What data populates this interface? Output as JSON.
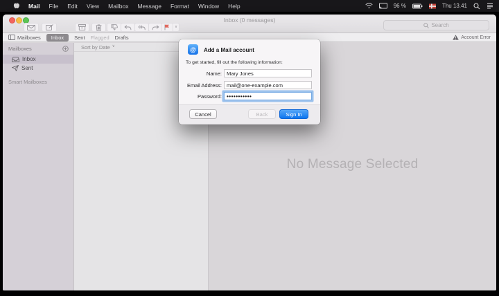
{
  "menu_bar": {
    "items": [
      "Mail",
      "File",
      "Edit",
      "View",
      "Mailbox",
      "Message",
      "Format",
      "Window",
      "Help"
    ],
    "status": {
      "battery": "96 %",
      "clock": "Thu 13.41"
    }
  },
  "window": {
    "title": "Inbox (0 messages)",
    "toolbar": {
      "search_placeholder": "Search"
    },
    "favorites": {
      "mailboxes": "Mailboxes",
      "inbox": "Inbox",
      "sent": "Sent",
      "flagged": "Flagged",
      "drafts": "Drafts",
      "account_error": "Account Error"
    },
    "sidebar": {
      "header": "Mailboxes",
      "inbox": "Inbox",
      "sent": "Sent",
      "smart": "Smart Mailboxes"
    },
    "list": {
      "sort_label": "Sort by Date"
    },
    "message_view": {
      "empty_text": "No Message Selected"
    }
  },
  "dialog": {
    "title": "Add a Mail account",
    "subtitle": "To get started, fill out the following information:",
    "fields": [
      {
        "label": "Name:",
        "value": "Mary Jones"
      },
      {
        "label": "Email Address:",
        "value": "mail@one-example.com"
      },
      {
        "label": "Password:",
        "value": "•••••••••••"
      }
    ],
    "buttons": {
      "cancel": "Cancel",
      "back": "Back",
      "sign_in": "Sign In"
    }
  },
  "icons": {
    "at": "@",
    "chevron": "∨",
    "names": [
      "apple-logo",
      "wifi",
      "display-mirroring",
      "battery",
      "input-source-flag",
      "spotlight-search",
      "notification-list",
      "get-mail-envelope",
      "compose",
      "archive-box",
      "trash",
      "junk-thumbs-down",
      "reply",
      "reply-all",
      "forward",
      "flag",
      "sidebar-panel",
      "warning-triangle",
      "inbox-tray",
      "sent-plane",
      "add-plus",
      "search-magnifier"
    ]
  },
  "colors": {
    "accent_blue": "#1876ee",
    "flag_red": "#e0695f",
    "selection": "#c7c0cc",
    "menubar": "#19181b"
  }
}
